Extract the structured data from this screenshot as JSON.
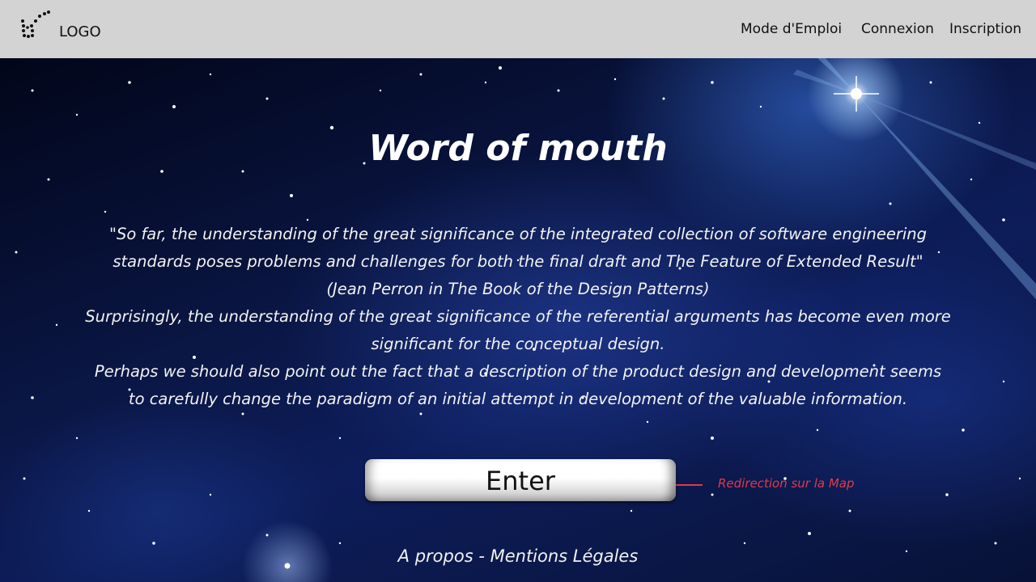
{
  "header": {
    "logo_text": "LOGO",
    "nav": {
      "mode_emploi": "Mode d'Emploi",
      "connexion": "Connexion",
      "inscription": "Inscription"
    }
  },
  "hero": {
    "title": "Word of mouth",
    "quote_lines": [
      "\"So far, the understanding of the great significance of the integrated collection of software engineering",
      "standards poses problems and challenges for both the final draft and The Feature of Extended Result\"",
      "(Jean Perron in The Book of the Design Patterns)",
      "Surprisingly, the understanding of the great significance of the referential arguments has become even more",
      "significant for the conceptual design.",
      "Perhaps we should also point out the fact that a description of the product design and development seems",
      "to carefully change the paradigm of an initial attempt in development of the valuable information."
    ],
    "enter_label": "Enter",
    "annotation": "Redirection sur la Map",
    "annotation_color": "#e03a4a"
  },
  "footer": {
    "apropos": "A propos",
    "separator": " - ",
    "mentions": "Mentions Légales"
  },
  "colors": {
    "navbar_bg": "#d3d3d3",
    "text_light": "#ffffff"
  }
}
